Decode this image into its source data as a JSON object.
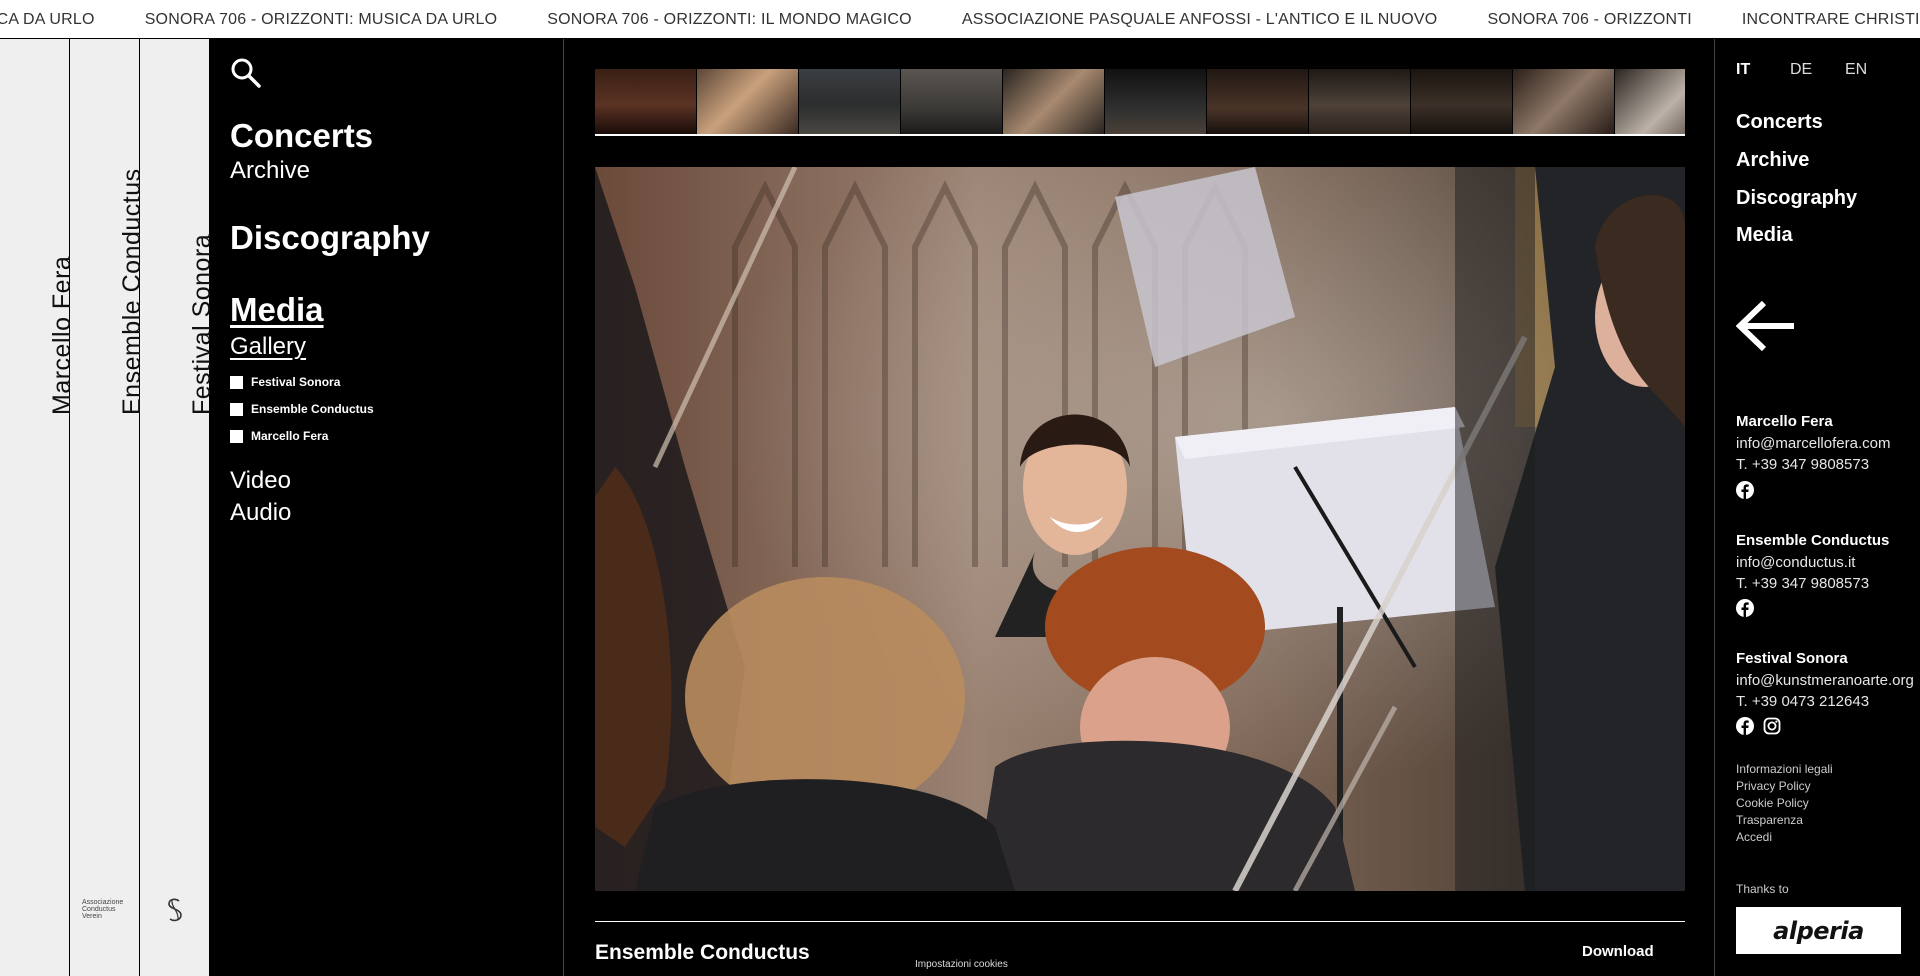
{
  "ticker": [
    "ICA DA URLO",
    "SONORA 706 - ORIZZONTI: MUSICA DA URLO",
    "SONORA 706 - ORIZZONTI: IL MONDO MAGICO",
    "ASSOCIAZIONE PASQUALE ANFOSSI - L'ANTICO E IL NUOVO",
    "SONORA 706 - ORIZZONTI",
    "INCONTRARE CHRISTIAN MARTINELLI BEGEGNEN - PEI"
  ],
  "columns": [
    "Marcello Fera",
    "Ensemble Conductus",
    "Festival Sonora"
  ],
  "assoc_logo": [
    "Associazione",
    "Conductus",
    "Verein"
  ],
  "left_nav": {
    "concerts": "Concerts",
    "archive": "Archive",
    "discography": "Discography",
    "media": "Media",
    "gallery": "Gallery",
    "filters": [
      "Festival Sonora",
      "Ensemble Conductus",
      "Marcello Fera"
    ],
    "video": "Video",
    "audio": "Audio"
  },
  "icons": {
    "search": "search-icon",
    "back": "arrow-left-icon",
    "facebook": "facebook-icon",
    "instagram": "instagram-icon"
  },
  "main": {
    "caption_title": "Ensemble Conductus",
    "download": "Download",
    "cookie_settings": "Impostazioni cookies",
    "thumbnail_count": 11
  },
  "right": {
    "languages": [
      "IT",
      "DE",
      "EN"
    ],
    "active_language": "IT",
    "nav": [
      "Concerts",
      "Archive",
      "Discography",
      "Media"
    ],
    "contacts": [
      {
        "name": "Marcello Fera",
        "email": "info@marcellofera.com",
        "phone": "T. +39 347 9808573"
      },
      {
        "name": "Ensemble Conductus",
        "email": "info@conductus.it",
        "phone": "T. +39 347 9808573"
      },
      {
        "name": "Festival Sonora",
        "email": "info@kunstmeranoarte.org",
        "phone": "T. +39 0473 212643"
      }
    ],
    "legal": [
      "Informazioni legali",
      "Privacy Policy",
      "Cookie Policy",
      "Trasparenza",
      "Accedi"
    ],
    "thanks": "Thanks to",
    "sponsor": "alperia"
  },
  "colors": {
    "background": "#000000",
    "column_bg": "#efefef",
    "ticker_bg": "#ffffff",
    "text": "#ffffff"
  }
}
